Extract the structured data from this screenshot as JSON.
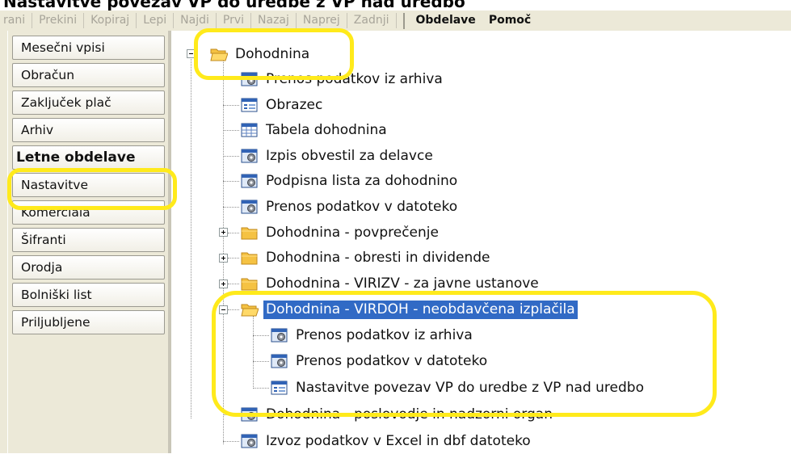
{
  "caption": "Nastavitve povezav VP do uredbe z VP nad uredbo",
  "toolbar": {
    "items": [
      "rani",
      "Prekini",
      "Kopiraj",
      "Lepi",
      "Najdi",
      "Prvi",
      "Nazaj",
      "Naprej",
      "Zadnji"
    ],
    "menu": [
      "Obdelave",
      "Pomoč"
    ]
  },
  "nav": [
    "Mesečni vpisi",
    "Obračun",
    "Zaključek plač",
    "Arhiv",
    "Letne obdelave",
    "Nastavitve",
    "Komerciala",
    "Šifranti",
    "Orodja",
    "Bolniški list",
    "Priljubljene"
  ],
  "tree": [
    {
      "label": "Dohodnina",
      "icon": "folder-open-icon"
    },
    {
      "label": "Prenos podatkov iz arhiva",
      "icon": "gear-window-icon"
    },
    {
      "label": "Obrazec",
      "icon": "form-icon"
    },
    {
      "label": "Tabela dohodnina",
      "icon": "table-icon"
    },
    {
      "label": "Izpis obvestil za delavce",
      "icon": "gear-window-icon"
    },
    {
      "label": "Podpisna lista za dohodnino",
      "icon": "gear-window-icon"
    },
    {
      "label": "Prenos podatkov v datoteko",
      "icon": "gear-window-icon"
    },
    {
      "label": "Dohodnina - povprečenje",
      "icon": "folder-icon"
    },
    {
      "label": "Dohodnina - obresti in dividende",
      "icon": "folder-icon"
    },
    {
      "label": "Dohodnina - VIRIZV - za javne ustanove",
      "icon": "folder-icon"
    },
    {
      "label": "Dohodnina - VIRDOH - neobdavčena izplačila",
      "icon": "folder-open-icon"
    },
    {
      "label": "Prenos podatkov iz arhiva",
      "icon": "gear-window-icon"
    },
    {
      "label": "Prenos podatkov v datoteko",
      "icon": "gear-window-icon"
    },
    {
      "label": "Nastavitve povezav VP do uredbe z VP nad uredbo",
      "icon": "form-icon"
    },
    {
      "label": "Dohodnina - poslovodje in nadzorni organ",
      "icon": "gear-window-icon"
    },
    {
      "label": "Izvoz podatkov v Excel in dbf datoteko",
      "icon": "gear-window-icon"
    }
  ],
  "colors": {
    "highlight": "#ffea1b",
    "selection": "#316ac5",
    "panel": "#ece9d8"
  }
}
